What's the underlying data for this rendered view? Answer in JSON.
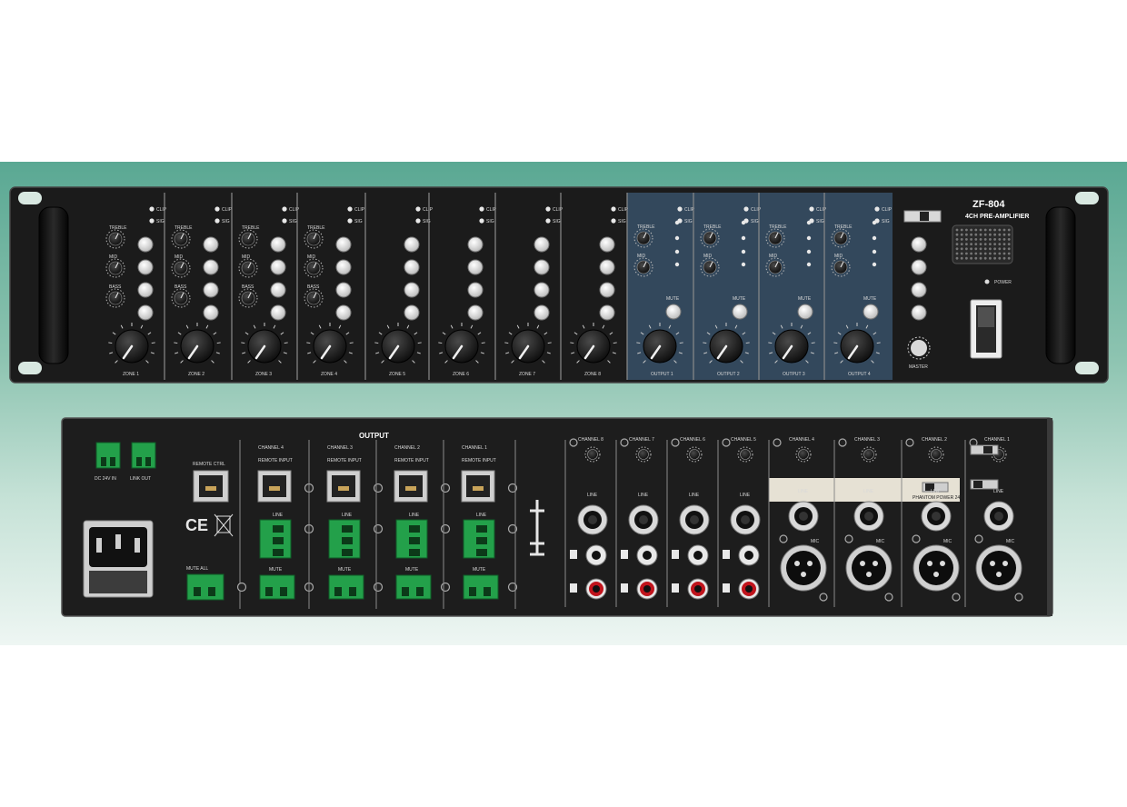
{
  "front_panel": {
    "model": "ZF-804",
    "subtitle": "4CH PRE-AMPLIFIER",
    "power_label": "POWER",
    "zone_labels": [
      "ZONE 1",
      "ZONE 2",
      "ZONE 3",
      "ZONE 4",
      "ZONE 5",
      "ZONE 6",
      "ZONE 7",
      "ZONE 8"
    ],
    "output_labels": [
      "OUTPUT 1",
      "OUTPUT 2",
      "OUTPUT 3",
      "OUTPUT 4"
    ],
    "mic_led_labels": [
      "CLIP",
      "SIG"
    ],
    "eq_labels": [
      "TREBLE",
      "MID",
      "BASS"
    ],
    "mute_label": "MUTE",
    "master_label": "MASTER"
  },
  "rear_panel": {
    "output_label": "OUTPUT",
    "dc_in_label": "DC 24V IN",
    "link_out_label": "LINK OUT",
    "remote_label": "REMOTE CTRL",
    "mute_all_label": "MUTE ALL",
    "ce_mark": "CE",
    "channel_out_labels": [
      "CHANNEL 4",
      "CHANNEL 3",
      "CHANNEL 2",
      "CHANNEL 1"
    ],
    "remote_input_label": "REMOTE INPUT",
    "line_label": "LINE",
    "mute_label": "MUTE",
    "input_channel_labels": [
      "CHANNEL 8",
      "CHANNEL 7",
      "CHANNEL 6",
      "CHANNEL 5",
      "CHANNEL 4",
      "CHANNEL 3",
      "CHANNEL 2",
      "CHANNEL 1"
    ],
    "phantom_label": "PHANTOM POWER 24V",
    "mic_label": "MIC"
  }
}
